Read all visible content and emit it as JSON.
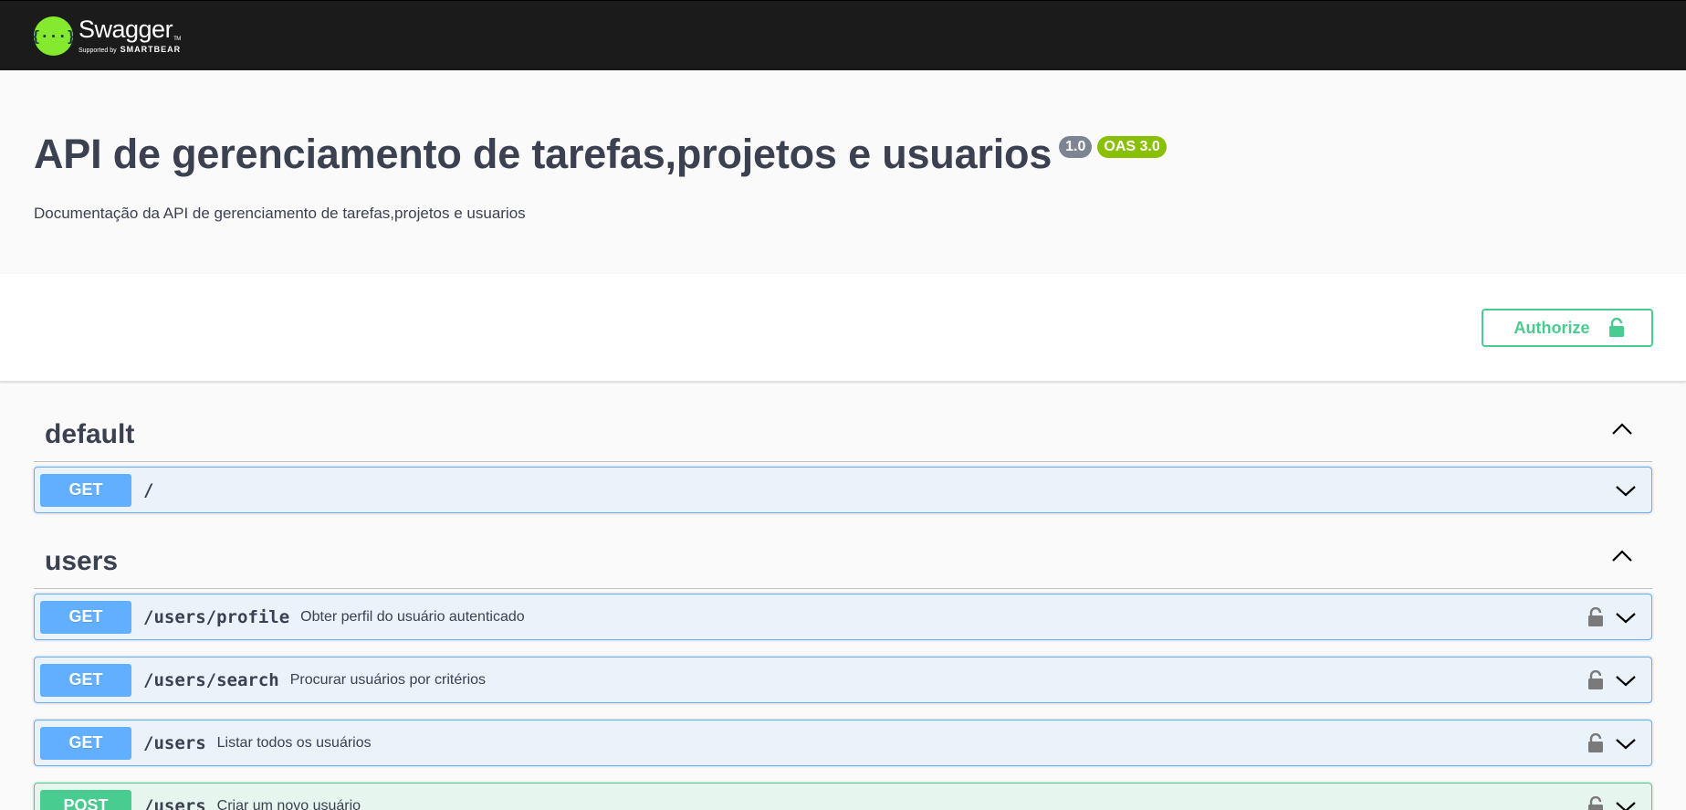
{
  "topbar": {
    "brand": "Swagger",
    "tm": "TM",
    "supported_by": "Supported by",
    "sponsor": "SMARTBEAR",
    "logo_bg": "#85ea2d"
  },
  "info": {
    "title": "API de gerenciamento de tarefas,projetos e usuarios",
    "version": "1.0",
    "oas": "OAS 3.0",
    "description": "Documentação da API de gerenciamento de tarefas,projetos e usuarios"
  },
  "auth": {
    "authorize_label": "Authorize",
    "icon": "lock-open-icon",
    "color": "#49cc90"
  },
  "tags": {
    "default": {
      "name": "default",
      "operations": [
        {
          "method": "GET",
          "path": "/",
          "summary": ""
        }
      ]
    },
    "users": {
      "name": "users",
      "operations": [
        {
          "method": "GET",
          "path": "/users/profile",
          "summary": "Obter perfil do usuário autenticado"
        },
        {
          "method": "GET",
          "path": "/users/search",
          "summary": "Procurar usuários por critérios"
        },
        {
          "method": "GET",
          "path": "/users",
          "summary": "Listar todos os usuários"
        },
        {
          "method": "POST",
          "path": "/users",
          "summary": "Criar um novo usuário"
        }
      ]
    }
  },
  "colors": {
    "get": "#61affe",
    "post": "#49cc90",
    "version_badge": "#7d8492",
    "oas_badge": "#89bf04"
  }
}
